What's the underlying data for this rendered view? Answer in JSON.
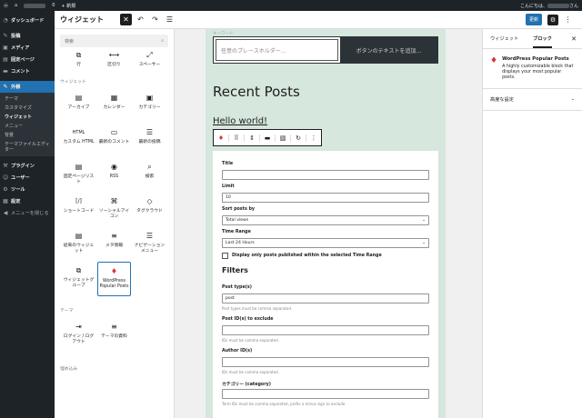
{
  "adminbar": {
    "wp": "ⓦ",
    "home": "⌂",
    "comments": "0",
    "new": "+ 新規",
    "greeting": "こんにちは、",
    "greeting_suffix": "さん"
  },
  "sidebar": {
    "items": [
      {
        "icon": "◔",
        "label": "ダッシュボード"
      },
      {
        "icon": "✎",
        "label": "投稿"
      },
      {
        "icon": "▣",
        "label": "メディア"
      },
      {
        "icon": "▤",
        "label": "固定ページ"
      },
      {
        "icon": "▬",
        "label": "コメント"
      },
      {
        "icon": "✎",
        "label": "外観"
      }
    ],
    "sub_items": [
      "テーマ",
      "カスタマイズ",
      "ウィジェット",
      "メニュー",
      "背景",
      "テーマファイルエディター"
    ],
    "lower_items": [
      {
        "icon": "⚒",
        "label": "プラグイン"
      },
      {
        "icon": "☺",
        "label": "ユーザー"
      },
      {
        "icon": "⚙",
        "label": "ツール"
      },
      {
        "icon": "▦",
        "label": "設定"
      },
      {
        "icon": "◀",
        "label": "メニューを閉じる"
      }
    ]
  },
  "editor": {
    "title": "ウィジェット",
    "add": "✕",
    "undo": "↶",
    "redo": "↷",
    "list": "☰",
    "update": "更新",
    "gear": "⚙",
    "more": "⋮"
  },
  "inserter": {
    "search_placeholder": "検索",
    "search_icon": "⌕",
    "top_blocks": [
      {
        "icon": "⧉",
        "label": "行"
      },
      {
        "icon": "⟷",
        "label": "区切り"
      },
      {
        "icon": "⤢",
        "label": "スペーサー"
      }
    ],
    "widgets_label": "ウィジェット",
    "widgets": [
      {
        "icon": "▤",
        "label": "アーカイブ"
      },
      {
        "icon": "▦",
        "label": "カレンダー"
      },
      {
        "icon": "▣",
        "label": "カテゴリー"
      },
      {
        "icon": "HTML",
        "label": "カスタム HTML"
      },
      {
        "icon": "▭",
        "label": "最新のコメント"
      },
      {
        "icon": "☰",
        "label": "最新の投稿"
      },
      {
        "icon": "▤",
        "label": "固定ページリスト"
      },
      {
        "icon": "◉",
        "label": "RSS"
      },
      {
        "icon": "⌕",
        "label": "検索"
      },
      {
        "icon": "[/]",
        "label": "ショートコード"
      },
      {
        "icon": "⌘",
        "label": "ソーシャルアイコン"
      },
      {
        "icon": "◇",
        "label": "タグクラウド"
      },
      {
        "icon": "▤",
        "label": "従来のウィジェット"
      },
      {
        "icon": "≡",
        "label": "メタ情報"
      },
      {
        "icon": "☰",
        "label": "ナビゲーションメニュー"
      },
      {
        "icon": "⧉",
        "label": "ウィジェットグループ"
      },
      {
        "icon": "♦",
        "label": "WordPress Popular Posts"
      }
    ],
    "theme_label": "テーマ",
    "theme_blocks": [
      {
        "icon": "⇥",
        "label": "ログイン / ログアウト"
      },
      {
        "icon": "≡",
        "label": "テーマの資料"
      }
    ],
    "embed_label": "埋め込み"
  },
  "canvas": {
    "faint_top": "キーワード",
    "search_placeholder": "任意のプレースホルダー…",
    "search_button": "ボタンのテキストを追加…",
    "recent_posts": "Recent Posts",
    "hello": "Hello world!",
    "toolbar": [
      "♦",
      "⠿",
      "⇕",
      "▬",
      "▧",
      "↻",
      "⋮"
    ],
    "form": {
      "title_label": "Title",
      "title_value": "",
      "limit_label": "Limit",
      "limit_value": "10",
      "sort_label": "Sort posts by",
      "sort_value": "Total views",
      "time_label": "Time Range",
      "time_value": "Last 24 Hours",
      "checkbox_label": "Display only posts published within the selected Time Range",
      "filters": "Filters",
      "post_type_label": "Post type(s)",
      "post_type_value": "post",
      "post_type_help": "Post types must be comma separated.",
      "exclude_label": "Post ID(s) to exclude",
      "exclude_help": "IDs must be comma separated.",
      "author_label": "Author ID(s)",
      "author_help": "IDs must be comma separated.",
      "category_label": "カテゴリー (category)",
      "category_help": "Term IDs must be comma separated, prefix a minus sign to exclude."
    }
  },
  "settings": {
    "tab_widgets": "ウィジェット",
    "tab_block": "ブロック",
    "close": "✕",
    "block_icon": "♦",
    "block_name": "WordPress Popular Posts",
    "block_desc": "A highly customizable block that displays your most popular posts.",
    "advanced": "高度な設定",
    "chevron": "⌄"
  }
}
